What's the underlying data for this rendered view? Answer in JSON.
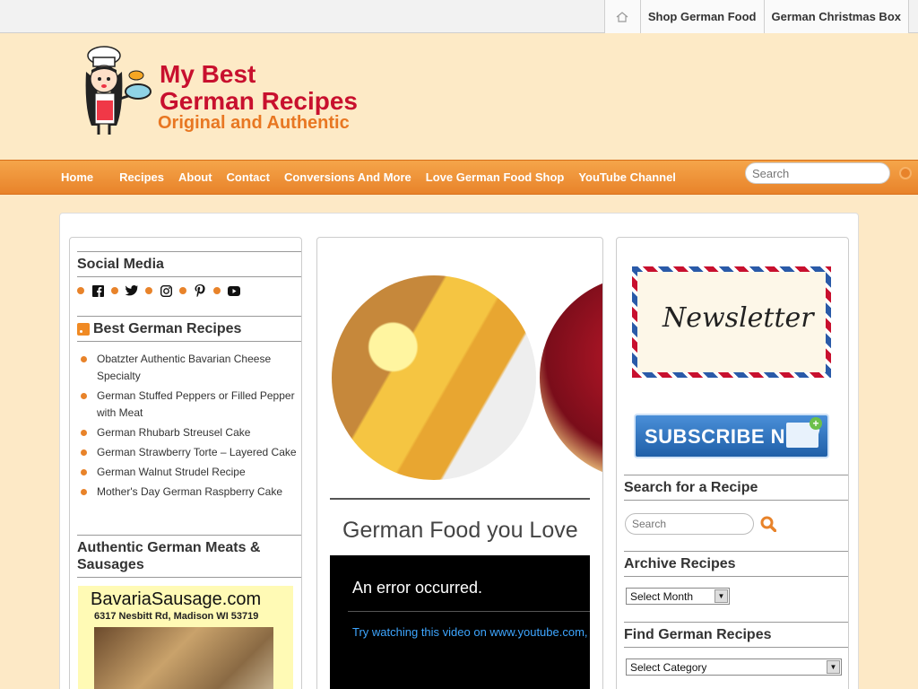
{
  "topnav": {
    "items": [
      "Shop German Food",
      "German Christmas Box"
    ]
  },
  "header": {
    "logo_line1": "My Best",
    "logo_line2": "German Recipes",
    "logo_tagline": "Original and Authentic"
  },
  "mainnav": {
    "items": [
      "Home",
      "Recipes",
      "About",
      "Contact",
      "Conversions And More",
      "Love German Food Shop",
      "YouTube Channel"
    ],
    "search_placeholder": "Search"
  },
  "left": {
    "social_title": "Social Media",
    "recipes_title": "Best German Recipes",
    "recipes": [
      "Obatzter Authentic Bavarian Cheese Specialty",
      "German Stuffed Peppers or Filled Pepper with Meat",
      "German Rhubarb Streusel Cake",
      "German Strawberry Torte – Layered Cake",
      "German Walnut Strudel Recipe",
      "Mother's Day German Raspberry Cake"
    ],
    "meats_title": "Authentic German Meats & Sausages",
    "ad_name": "BavariaSausage.com",
    "ad_address": "6317 Nesbitt Rd, Madison WI 53719"
  },
  "middle": {
    "section_title": "German Food you Love",
    "video_error": "An error occurred.",
    "video_link": "Try watching this video on www.youtube.com,"
  },
  "right": {
    "newsletter_text": "Newsletter",
    "subscribe_text": "SUBSCRIBE NOW",
    "search_title": "Search for a Recipe",
    "search_placeholder": "Search",
    "archive_title": "Archive Recipes",
    "archive_select": "Select Month",
    "find_title": "Find German Recipes",
    "find_select": "Select Category"
  },
  "colors": {
    "accent_orange": "#e8832a",
    "brand_red": "#c8102e",
    "header_bg": "#fdeac6"
  }
}
